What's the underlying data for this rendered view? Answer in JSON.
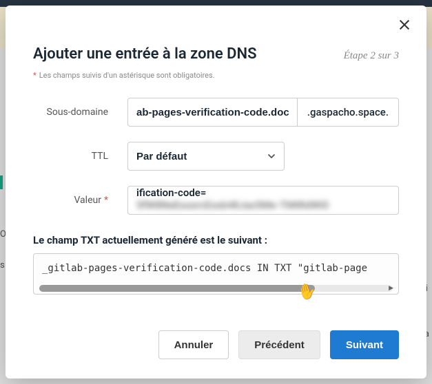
{
  "modal": {
    "title": "Ajouter une entrée à la zone DNS",
    "step": "Étape 2 sur 3",
    "required_note": "Les champs suivis d'un astérisque sont obligatoires."
  },
  "form": {
    "subdomain": {
      "label": "Sous-domaine",
      "value": "ab-pages-verification-code.docs",
      "suffix": ".gaspacho.space."
    },
    "ttl": {
      "label": "TTL",
      "value": "Par défaut"
    },
    "value": {
      "label": "Valeur",
      "prefix": "ification-code=",
      "redacted": "5fW8NeEsoxrcExsb48Jax5Me-TMtRdWi0"
    },
    "generated_label": "Le champ TXT actuellement généré est le suivant :",
    "generated_value": "_gitlab-pages-verification-code.docs IN TXT \"gitlab-page"
  },
  "footer": {
    "cancel": "Annuler",
    "previous": "Précédent",
    "next": "Suivant"
  }
}
